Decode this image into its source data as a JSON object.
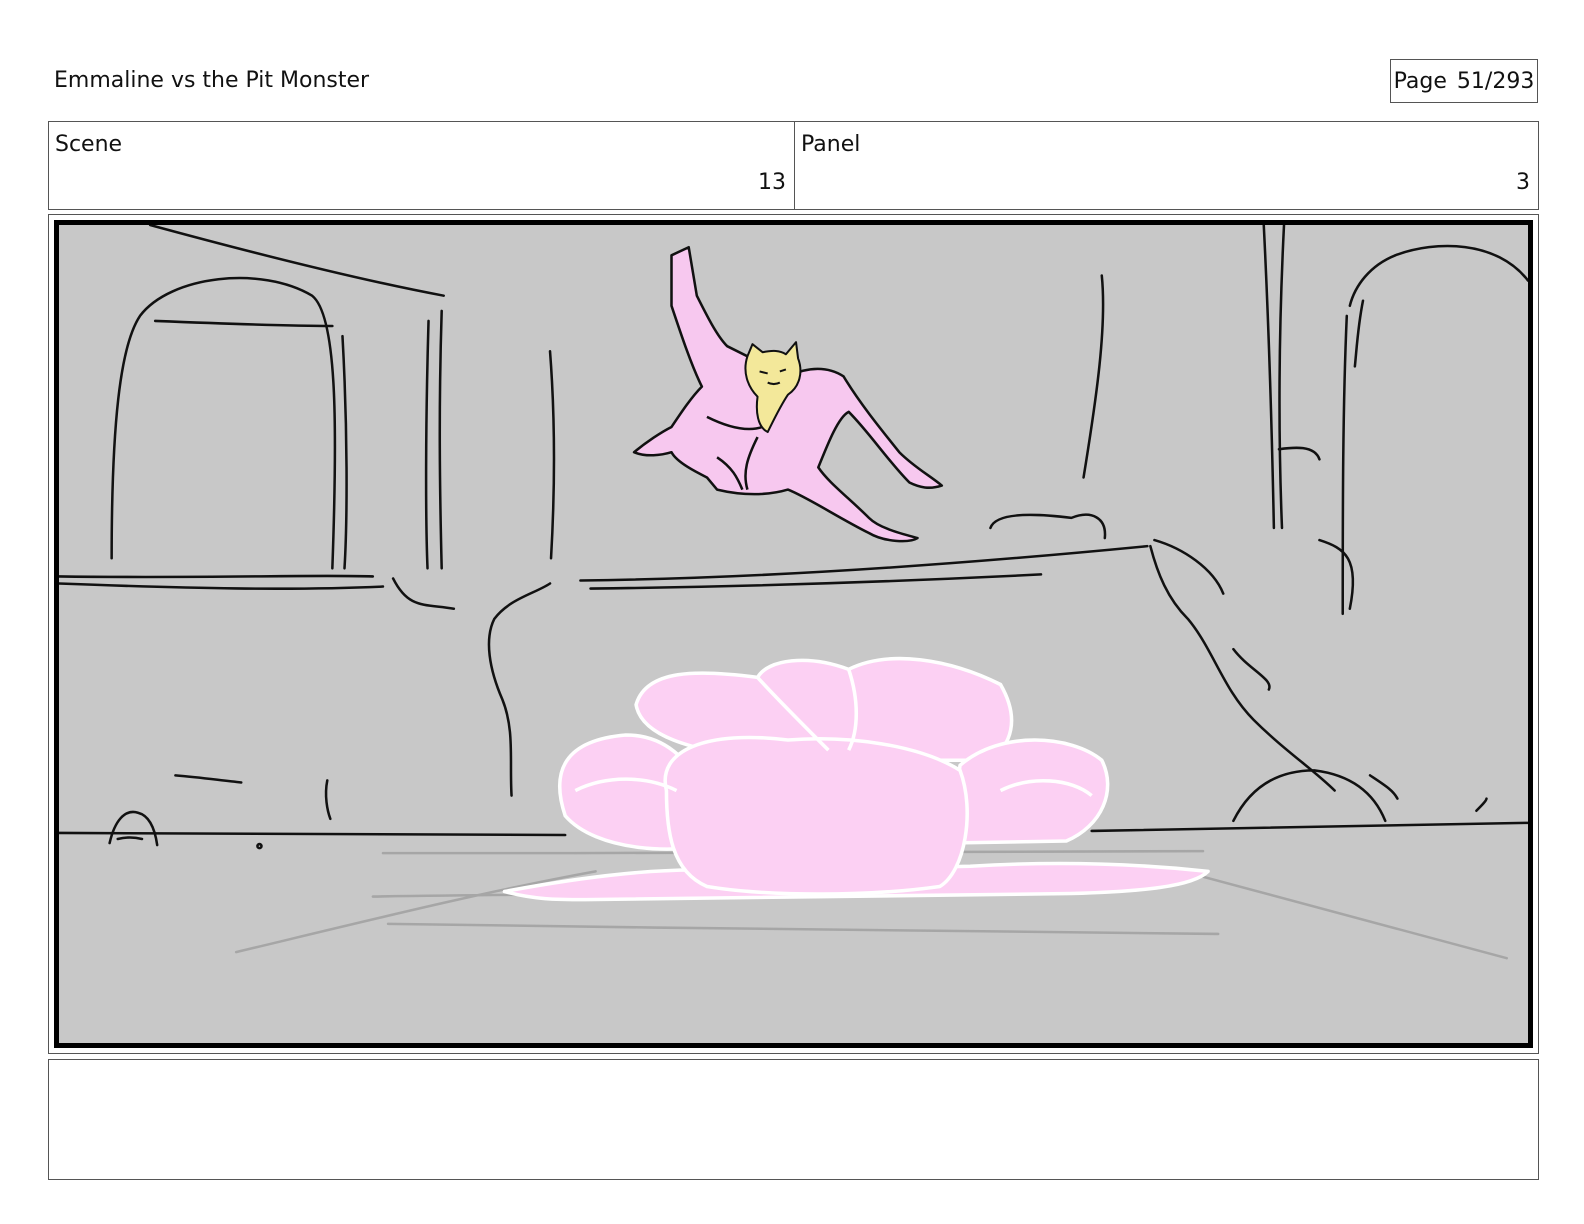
{
  "header": {
    "title": "Emmaline vs the Pit Monster",
    "page_label": "Page",
    "page_value": "51/293"
  },
  "info": {
    "scene_label": "Scene",
    "scene_value": "13",
    "panel_label": "Panel",
    "panel_value": "3"
  },
  "notes": {
    "text": ""
  },
  "colors": {
    "panel_background": "#c8c8c8",
    "sketch_line": "#000000",
    "character_pink": "#f7c8ef",
    "bow_pink": "#fcd0f3",
    "cat_yellow": "#f3e89a"
  }
}
